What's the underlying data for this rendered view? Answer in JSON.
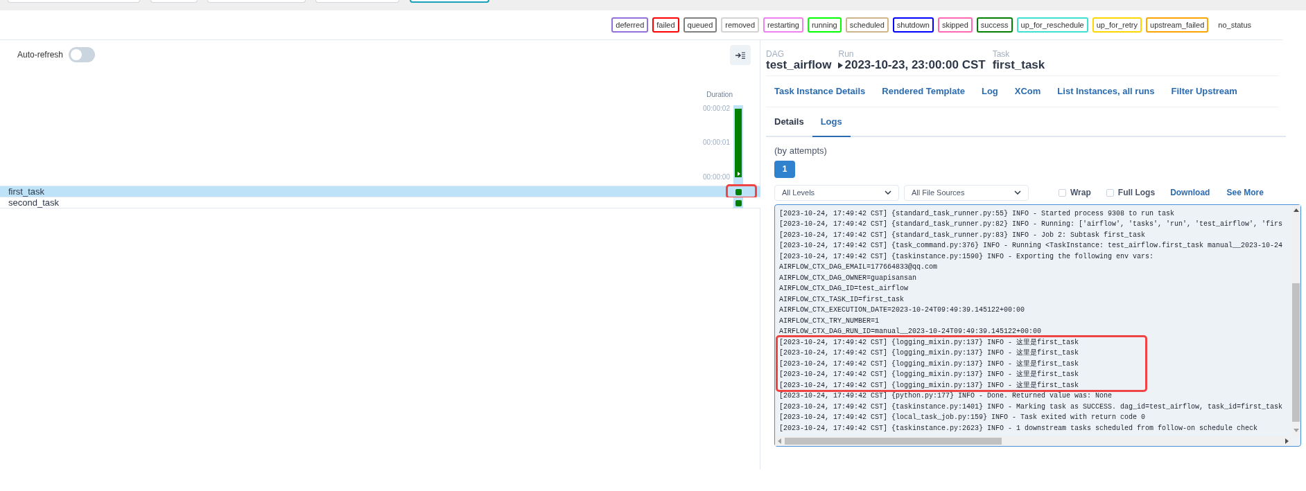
{
  "legend": [
    {
      "label": "deferred",
      "color": "#9370db"
    },
    {
      "label": "failed",
      "color": "#ff0000"
    },
    {
      "label": "queued",
      "color": "#808080"
    },
    {
      "label": "removed",
      "color": "#d3d3d3"
    },
    {
      "label": "restarting",
      "color": "#ee82ee"
    },
    {
      "label": "running",
      "color": "#00ff00"
    },
    {
      "label": "scheduled",
      "color": "#d2b48c"
    },
    {
      "label": "shutdown",
      "color": "#0000ff"
    },
    {
      "label": "skipped",
      "color": "#ff69b4"
    },
    {
      "label": "success",
      "color": "#008000"
    },
    {
      "label": "up_for_reschedule",
      "color": "#40e0d0"
    },
    {
      "label": "up_for_retry",
      "color": "#ffd700"
    },
    {
      "label": "upstream_failed",
      "color": "#ffa500"
    },
    {
      "label": "no_status"
    }
  ],
  "auto_refresh": {
    "label": "Auto-refresh",
    "on": false
  },
  "duration_chart": {
    "title": "Duration",
    "ticks": [
      "00:00:02",
      "00:00:01",
      "00:00:00"
    ],
    "runs": [
      {
        "color": "#008000",
        "level": 1
      }
    ]
  },
  "tasks": [
    {
      "name": "first_task",
      "selected": true,
      "color": "#008000",
      "highlighted": true
    },
    {
      "name": "second_task",
      "selected": false,
      "color": "#008000",
      "highlighted": false
    }
  ],
  "breadcrumb": [
    {
      "label": "DAG",
      "value": "test_airflow",
      "kind": "plain"
    },
    {
      "label": "Run",
      "value": "2023-10-23, 23:00:00 CST",
      "kind": "run"
    },
    {
      "label": "Task",
      "value": "first_task",
      "kind": "plain"
    }
  ],
  "nav_links": [
    "Task Instance Details",
    "Rendered Template",
    "Log",
    "XCom",
    "List Instances, all runs",
    "Filter Upstream"
  ],
  "tabs": [
    {
      "label": "Details",
      "selected": false
    },
    {
      "label": "Logs",
      "selected": true
    }
  ],
  "attempts": {
    "label": "(by attempts)",
    "buttons": [
      {
        "label": "1",
        "selected": true
      }
    ]
  },
  "filters": [
    {
      "kind": "select",
      "value": "All Levels"
    },
    {
      "kind": "select",
      "value": "All File Sources"
    },
    {
      "kind": "checkbox",
      "label": "Wrap",
      "checked": false
    },
    {
      "kind": "checkbox",
      "label": "Full Logs",
      "checked": false
    },
    {
      "kind": "link",
      "label": "Download"
    },
    {
      "kind": "link",
      "label": "See More"
    }
  ],
  "log_lines": [
    {
      "text": "[2023-10-24, 17:49:42 CST] {standard_task_runner.py:55} INFO - Started process 9308 to run task",
      "highlighted": false
    },
    {
      "text": "[2023-10-24, 17:49:42 CST] {standard_task_runner.py:82} INFO - Running: ['airflow', 'tasks', 'run', 'test_airflow', 'firs",
      "highlighted": false
    },
    {
      "text": "[2023-10-24, 17:49:42 CST] {standard_task_runner.py:83} INFO - Job 2: Subtask first_task",
      "highlighted": false
    },
    {
      "text": "[2023-10-24, 17:49:42 CST] {task_command.py:376} INFO - Running <TaskInstance: test_airflow.first_task manual__2023-10-24",
      "highlighted": false
    },
    {
      "text": "[2023-10-24, 17:49:42 CST] {taskinstance.py:1590} INFO - Exporting the following env vars:",
      "highlighted": false
    },
    {
      "text": "AIRFLOW_CTX_DAG_EMAIL=177664833@qq.com",
      "highlighted": false
    },
    {
      "text": "AIRFLOW_CTX_DAG_OWNER=guapisansan",
      "highlighted": false
    },
    {
      "text": "AIRFLOW_CTX_DAG_ID=test_airflow",
      "highlighted": false
    },
    {
      "text": "AIRFLOW_CTX_TASK_ID=first_task",
      "highlighted": false
    },
    {
      "text": "AIRFLOW_CTX_EXECUTION_DATE=2023-10-24T09:49:39.145122+00:00",
      "highlighted": false
    },
    {
      "text": "AIRFLOW_CTX_TRY_NUMBER=1",
      "highlighted": false
    },
    {
      "text": "AIRFLOW_CTX_DAG_RUN_ID=manual__2023-10-24T09:49:39.145122+00:00",
      "highlighted": false
    },
    {
      "text": "[2023-10-24, 17:49:42 CST] {logging_mixin.py:137} INFO - 这里是first_task",
      "highlighted": true
    },
    {
      "text": "[2023-10-24, 17:49:42 CST] {logging_mixin.py:137} INFO - 这里是first_task",
      "highlighted": true
    },
    {
      "text": "[2023-10-24, 17:49:42 CST] {logging_mixin.py:137} INFO - 这里是first_task",
      "highlighted": true
    },
    {
      "text": "[2023-10-24, 17:49:42 CST] {logging_mixin.py:137} INFO - 这里是first_task",
      "highlighted": true
    },
    {
      "text": "[2023-10-24, 17:49:42 CST] {logging_mixin.py:137} INFO - 这里是first_task",
      "highlighted": true
    },
    {
      "text": "[2023-10-24, 17:49:42 CST] {python.py:177} INFO - Done. Returned value was: None",
      "highlighted": false
    },
    {
      "text": "[2023-10-24, 17:49:42 CST] {taskinstance.py:1401} INFO - Marking task as SUCCESS. dag_id=test_airflow, task_id=first_task",
      "highlighted": false
    },
    {
      "text": "[2023-10-24, 17:49:42 CST] {local_task_job.py:159} INFO - Task exited with return code 0",
      "highlighted": false
    },
    {
      "text": "[2023-10-24, 17:49:42 CST] {taskinstance.py:2623} INFO - 1 downstream tasks scheduled from follow-on schedule check",
      "highlighted": false
    }
  ]
}
